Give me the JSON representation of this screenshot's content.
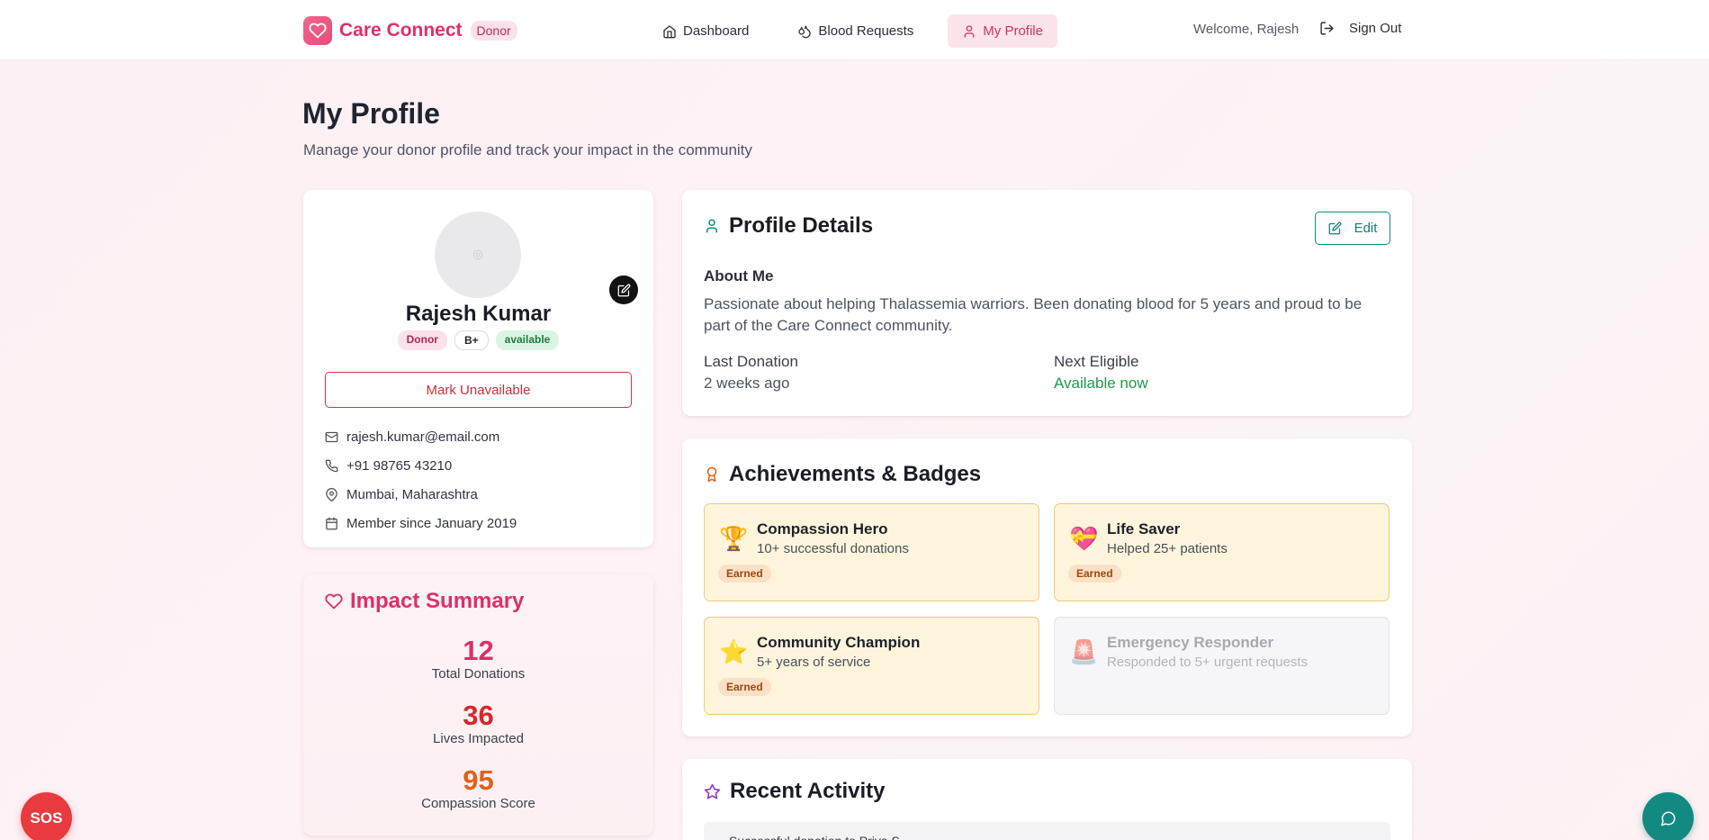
{
  "header": {
    "brand": "Care Connect",
    "role": "Donor",
    "nav": [
      {
        "label": "Dashboard",
        "icon": "home-icon"
      },
      {
        "label": "Blood Requests",
        "icon": "droplet-icon"
      },
      {
        "label": "My Profile",
        "icon": "user-icon",
        "active": true
      }
    ],
    "welcome": "Welcome, Rajesh",
    "signout": "Sign Out"
  },
  "page": {
    "title": "My Profile",
    "subtitle": "Manage your donor profile and track your impact in the community"
  },
  "profile": {
    "name": "Rajesh Kumar",
    "role_tag": "Donor",
    "blood_group": "B+",
    "status": "available",
    "toggle_label": "Mark Unavailable",
    "email": "rajesh.kumar@email.com",
    "phone": "+91 98765 43210",
    "location": "Mumbai, Maharashtra",
    "member_since": "Member since January 2019"
  },
  "impact": {
    "title": "Impact Summary",
    "stats": [
      {
        "value": "12",
        "label": "Total Donations",
        "color": "#dc2f6b"
      },
      {
        "value": "36",
        "label": "Lives Impacted",
        "color": "#d9262c"
      },
      {
        "value": "95",
        "label": "Compassion Score",
        "color": "#e26015"
      }
    ]
  },
  "details": {
    "title": "Profile Details",
    "edit_label": "Edit",
    "about_label": "About Me",
    "about_text": "Passionate about helping Thalassemia warriors. Been donating blood for 5 years and proud to be part of the Care Connect community.",
    "last_donation_label": "Last Donation",
    "last_donation_value": "2 weeks ago",
    "next_eligible_label": "Next Eligible",
    "next_eligible_value": "Available now"
  },
  "achievements": {
    "title": "Achievements & Badges",
    "badges": [
      {
        "icon": "🏆",
        "title": "Compassion Hero",
        "desc": "10+ successful donations",
        "earned": "Earned"
      },
      {
        "icon": "💝",
        "title": "Life Saver",
        "desc": "Helped 25+ patients",
        "earned": "Earned"
      },
      {
        "icon": "⭐",
        "title": "Community Champion",
        "desc": "5+ years of service",
        "earned": "Earned"
      },
      {
        "icon": "🚨",
        "title": "Emergency Responder",
        "desc": "Responded to 5+ urgent requests",
        "earned": ""
      }
    ]
  },
  "activity": {
    "title": "Recent Activity",
    "first_item": "Successful donation to Priya S."
  },
  "floating": {
    "sos": "SOS"
  },
  "colors": {
    "brand": "#e0306a",
    "teal": "#138a8a",
    "danger": "#d6353f",
    "success": "#1e9a4a"
  }
}
